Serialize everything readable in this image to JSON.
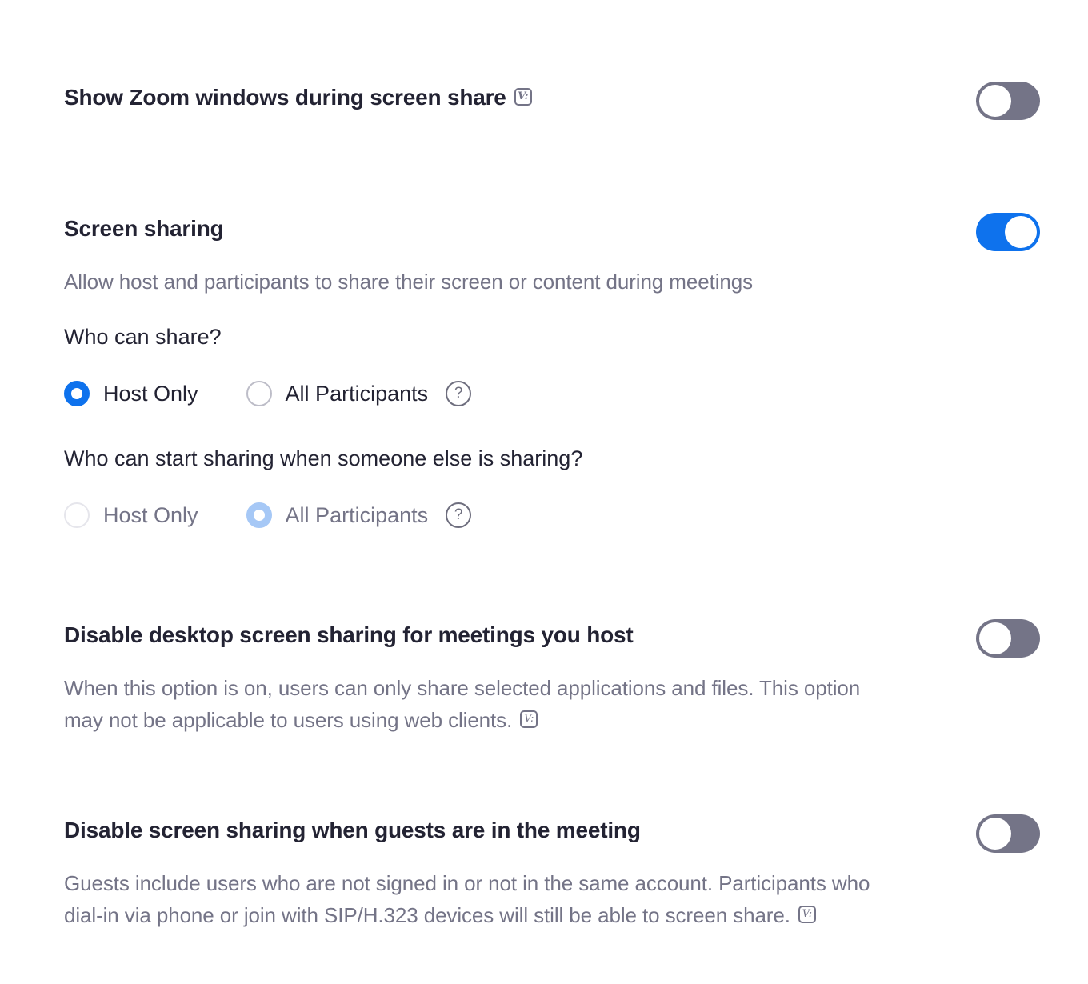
{
  "settings": {
    "show_zoom_windows": {
      "title": "Show Zoom windows during screen share",
      "badge": "V:",
      "toggle": "off"
    },
    "screen_sharing": {
      "title": "Screen sharing",
      "description": "Allow host and participants to share their screen or content during meetings",
      "toggle": "on",
      "who_can_share": {
        "question": "Who can share?",
        "options": [
          "Host Only",
          "All Participants"
        ],
        "selected": "Host Only"
      },
      "who_can_start": {
        "question": "Who can start sharing when someone else is sharing?",
        "options": [
          "Host Only",
          "All Participants"
        ],
        "selected": "All Participants",
        "disabled": true
      },
      "help_icon_glyph": "?"
    },
    "disable_desktop": {
      "title": "Disable desktop screen sharing for meetings you host",
      "description_line1": "When this option is on, users can only share selected applications and files. This option",
      "description_line2": "may not be applicable to users using web clients.",
      "badge": "V:",
      "toggle": "off"
    },
    "disable_guests": {
      "title": "Disable screen sharing when guests are in the meeting",
      "description_line1": "Guests include users who are not signed in or not in the same account. Participants who",
      "description_line2": "dial-in via phone or join with SIP/H.323 devices will still be able to screen share.",
      "badge": "V:",
      "toggle": "off"
    }
  },
  "colors": {
    "accent": "#0e72ed",
    "toggle_off": "#747487",
    "text_primary": "#232333",
    "text_secondary": "#747487"
  }
}
